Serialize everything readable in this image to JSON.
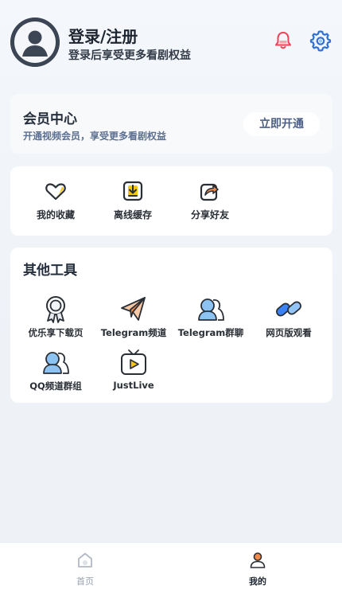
{
  "header": {
    "login_title": "登录/注册",
    "login_subtitle": "登录后享受更多看剧权益"
  },
  "vip": {
    "title": "会员中心",
    "description": "开通视频会员，享受更多看剧权益",
    "button": "立即开通"
  },
  "quick_actions": [
    {
      "label": "我的收藏",
      "icon": "heart-icon"
    },
    {
      "label": "离线缓存",
      "icon": "download-icon"
    },
    {
      "label": "分享好友",
      "icon": "share-icon"
    }
  ],
  "tools": {
    "title": "其他工具",
    "items": [
      {
        "label": "优乐享下载页",
        "icon": "badge-icon"
      },
      {
        "label": "Telegram频道",
        "icon": "paper-plane-icon"
      },
      {
        "label": "Telegram群聊",
        "icon": "group-icon"
      },
      {
        "label": "网页版观看",
        "icon": "link-icon"
      },
      {
        "label": "QQ频道群组",
        "icon": "group-icon"
      },
      {
        "label": "JustLive",
        "icon": "tv-icon"
      }
    ]
  },
  "tabbar": {
    "home": "首页",
    "mine": "我的"
  },
  "colors": {
    "accent": "#3b82f6",
    "orange": "#f08a4b",
    "yellow": "#f5c518",
    "bell": "#f0435a"
  }
}
